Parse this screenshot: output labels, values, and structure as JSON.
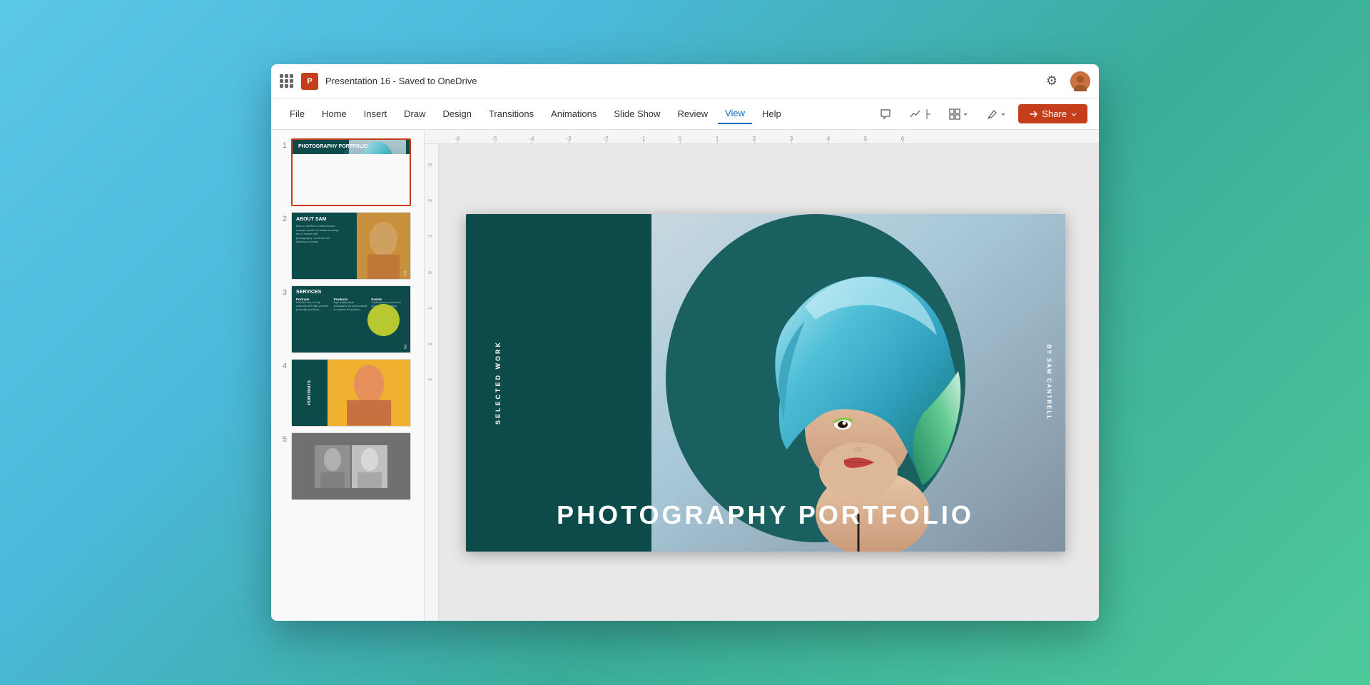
{
  "window": {
    "title": "Presentation 16 - Saved to OneDrive",
    "save_status": "Saved to OneDrive"
  },
  "menu": {
    "items": [
      {
        "id": "file",
        "label": "File"
      },
      {
        "id": "home",
        "label": "Home"
      },
      {
        "id": "insert",
        "label": "Insert"
      },
      {
        "id": "draw",
        "label": "Draw"
      },
      {
        "id": "design",
        "label": "Design"
      },
      {
        "id": "transitions",
        "label": "Transitions"
      },
      {
        "id": "animations",
        "label": "Animations"
      },
      {
        "id": "slideshow",
        "label": "Slide Show"
      },
      {
        "id": "review",
        "label": "Review"
      },
      {
        "id": "view",
        "label": "View",
        "active": true
      },
      {
        "id": "help",
        "label": "Help"
      }
    ],
    "share_label": "Share"
  },
  "slides": [
    {
      "number": "1",
      "title": "PHOTOGRAPHY PORTFOLIO",
      "active": true
    },
    {
      "number": "2",
      "title": "ABOUT SAM",
      "active": false
    },
    {
      "number": "3",
      "title": "SERVICES",
      "active": false
    },
    {
      "number": "4",
      "title": "PORTRAITS",
      "active": false
    },
    {
      "number": "5",
      "title": "",
      "active": false
    }
  ],
  "slide_content": {
    "left_vertical_text": "SELECTED WORK",
    "right_vertical_text": "BY SAM CANTRELL",
    "main_title": "PHOTOGRAPHY PORTFOLIO"
  },
  "ruler": {
    "marks": [
      "-6",
      "-5",
      "-4",
      "-3",
      "-2",
      "-1",
      "0",
      "1",
      "2",
      "3",
      "4",
      "5",
      "6"
    ]
  },
  "colors": {
    "slide_bg": "#0d4a4a",
    "slide_circle": "#1a6060",
    "accent_red": "#c43e1c",
    "text_white": "#ffffff",
    "view_active": "#106ebe"
  }
}
